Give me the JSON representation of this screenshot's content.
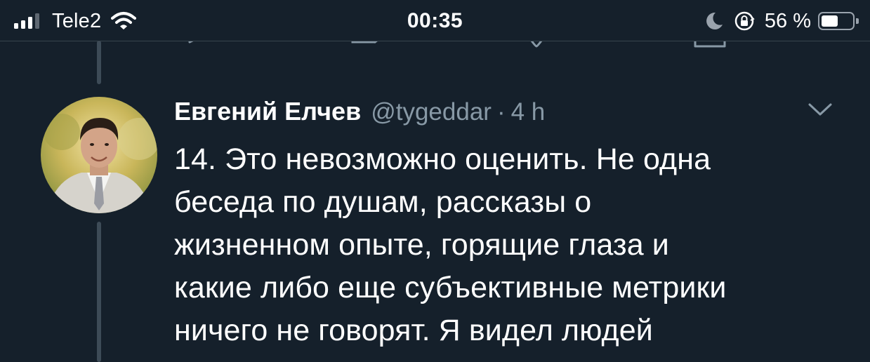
{
  "status_bar": {
    "carrier": "Tele2",
    "time": "00:35",
    "battery_percent": "56 %",
    "battery_level": 0.56,
    "signal_bars_active": 3,
    "signal_bars_total": 4,
    "icons": [
      "signal-icon",
      "wifi-icon",
      "moon-icon",
      "orientation-lock-icon",
      "battery-icon"
    ]
  },
  "previous_tweet_actions": {
    "icons": [
      "reply-icon",
      "retweet-icon",
      "like-icon",
      "share-icon"
    ]
  },
  "tweet": {
    "author_name": "Евгений Елчев",
    "handle": "@tygeddar",
    "separator": "·",
    "age": "4 h",
    "text_lines": [
      "14. Это невозможно оценить. Не одна",
      "беседа по душам, рассказы о",
      "жизненном опыте, горящие глаза и",
      "какие либо еще субъективные метрики",
      "ничего не говорят. Я видел людей"
    ]
  },
  "colors": {
    "background": "#15202b",
    "secondary_text": "#8899a6",
    "thread_line": "#3d4b57",
    "divider": "#38444d"
  }
}
